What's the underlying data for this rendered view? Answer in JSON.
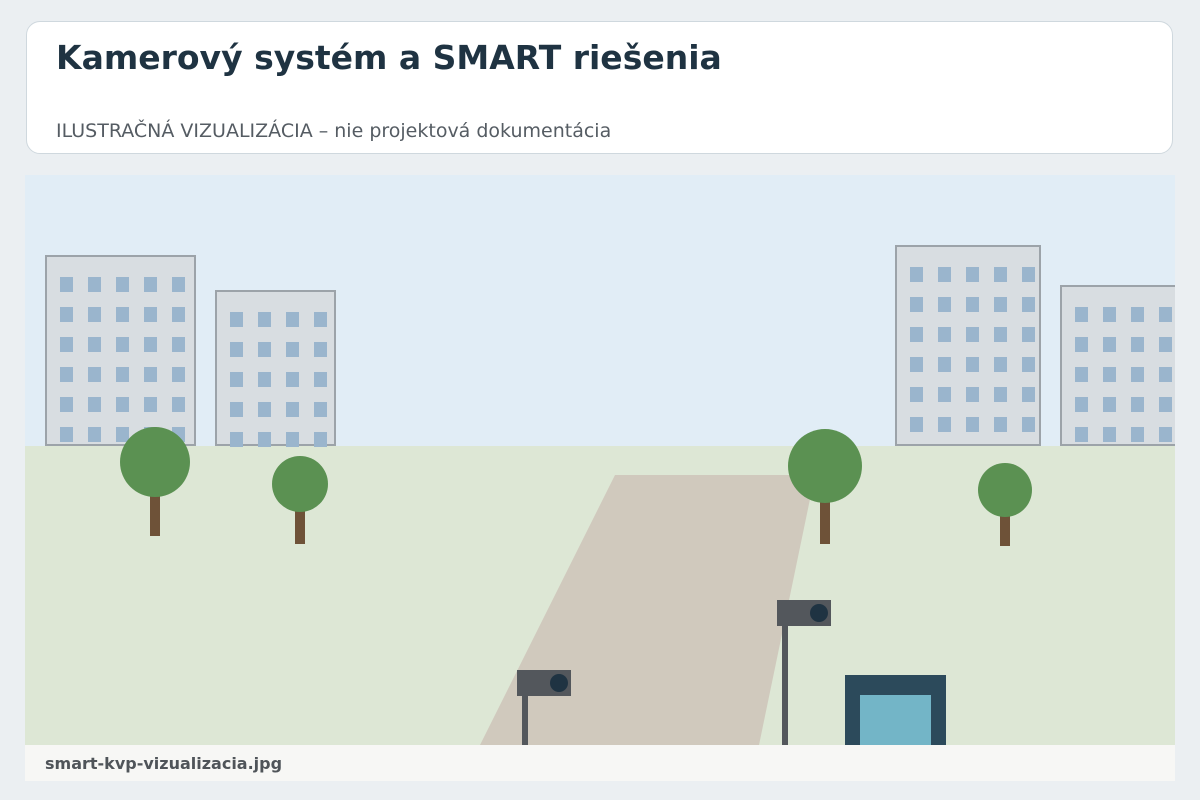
{
  "header": {
    "title": "Kamerový systém a SMART riešenia",
    "subtitle": "ILUSTRAČNÁ VIZUALIZÁCIA – nie projektová dokumentácia"
  },
  "image": {
    "caption": "smart-kvp-vizualizacia.jpg"
  },
  "colors": {
    "page_background": "#ebeff2",
    "title": "#1f3342",
    "sky": "#e1edf6",
    "grass": "#dde7d5",
    "path": "#d0c9bd",
    "building": "#d8dde1",
    "window": "#9ab5cd",
    "tree_crown": "#5b9152",
    "tree_trunk": "#6e5238",
    "camera": "#53575c",
    "kiosk_frame": "#2c4a5b",
    "kiosk_screen": "#73b5c7"
  },
  "icons": [
    "building-icon",
    "tree-icon",
    "security-camera-icon",
    "info-kiosk-icon"
  ]
}
